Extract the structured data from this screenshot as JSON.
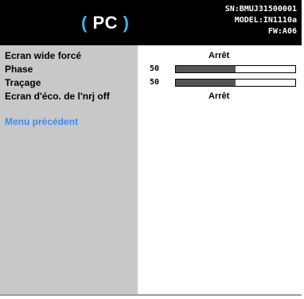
{
  "header": {
    "source_paren_open": "(",
    "source": "PC",
    "source_paren_close": ")",
    "sn": "SN:BMUJ31500001",
    "model": "MODEL:IN1110a",
    "fw": "FW:A06"
  },
  "menu": {
    "items": [
      {
        "label": "Ecran wide forcé",
        "value": "Arrêt"
      },
      {
        "label": "Phase",
        "number": "50",
        "level": 0.5
      },
      {
        "label": "Traçage",
        "number": "50",
        "level": 0.5
      },
      {
        "label": "Ecran d'éco. de l'nrj off",
        "value": "Arrêt"
      }
    ],
    "back": "Menu précédent"
  },
  "colors": {
    "accent": "#39b6ea",
    "link": "#3f8cf0",
    "panel": "#c8c8c8",
    "bar_fill": "#555555"
  }
}
